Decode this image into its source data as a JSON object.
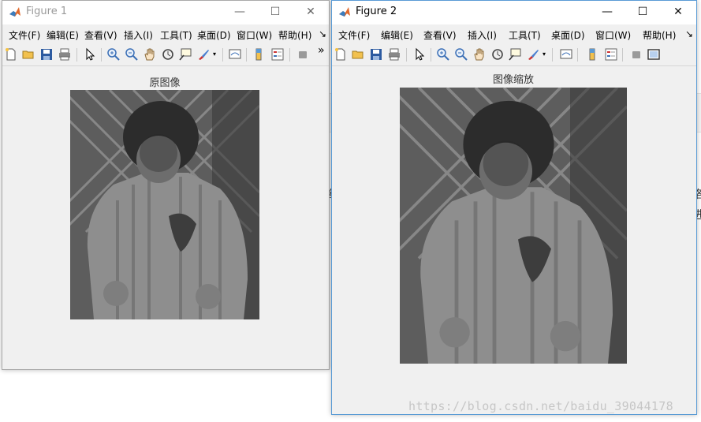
{
  "background": {
    "fragments": [
      "洛",
      "约",
      "进"
    ]
  },
  "figure1": {
    "title": "Figure 1",
    "axes_title": "原图像",
    "menus": [
      "文件(F)",
      "编辑(E)",
      "查看(V)",
      "插入(I)",
      "工具(T)",
      "桌面(D)",
      "窗口(W)",
      "帮助(H)",
      "↘"
    ],
    "overflow": "»"
  },
  "figure2": {
    "title": "Figure 2",
    "axes_title": "图像缩放",
    "menus": [
      "文件(F)",
      "编辑(E)",
      "查看(V)",
      "插入(I)",
      "工具(T)",
      "桌面(D)",
      "窗口(W)",
      "帮助(H)",
      "↘"
    ]
  },
  "window_controls": {
    "minimize": "—",
    "maximize": "☐",
    "close": "✕"
  },
  "watermark": "https://blog.csdn.net/baidu_39044178",
  "colors": {
    "window_bg": "#f0f0f0",
    "active_border": "#5a9bd5",
    "photo_gray": "#5c5c5c"
  }
}
